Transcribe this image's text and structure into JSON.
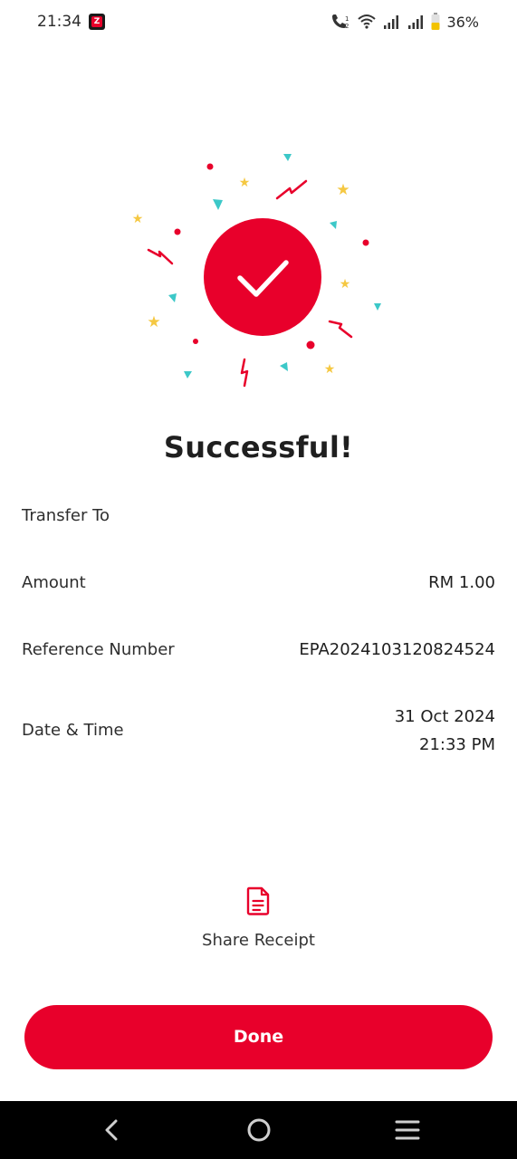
{
  "status_bar": {
    "time": "21:34",
    "battery_percent": "36%",
    "icons": [
      "app-notification-icon",
      "wifi-calling-icon",
      "wifi-icon",
      "signal-icon",
      "signal-icon",
      "battery-icon"
    ]
  },
  "title": "Successful!",
  "details": {
    "transfer_to_label": "Transfer To",
    "transfer_to_value": "",
    "amount_label": "Amount",
    "amount_value": "RM 1.00",
    "reference_label": "Reference Number",
    "reference_value": "EPA2024103120824524",
    "datetime_label": "Date & Time",
    "date_value": "31 Oct 2024",
    "time_value": "21:33 PM"
  },
  "share": {
    "label": "Share Receipt",
    "icon": "document-icon"
  },
  "done_button": {
    "label": "Done"
  },
  "nav": {
    "icons": [
      "back-icon",
      "home-icon",
      "recents-icon"
    ]
  },
  "colors": {
    "accent": "#e8002b",
    "confetti_yellow": "#f5c842",
    "confetti_teal": "#3cc8c8",
    "text": "#222222"
  }
}
